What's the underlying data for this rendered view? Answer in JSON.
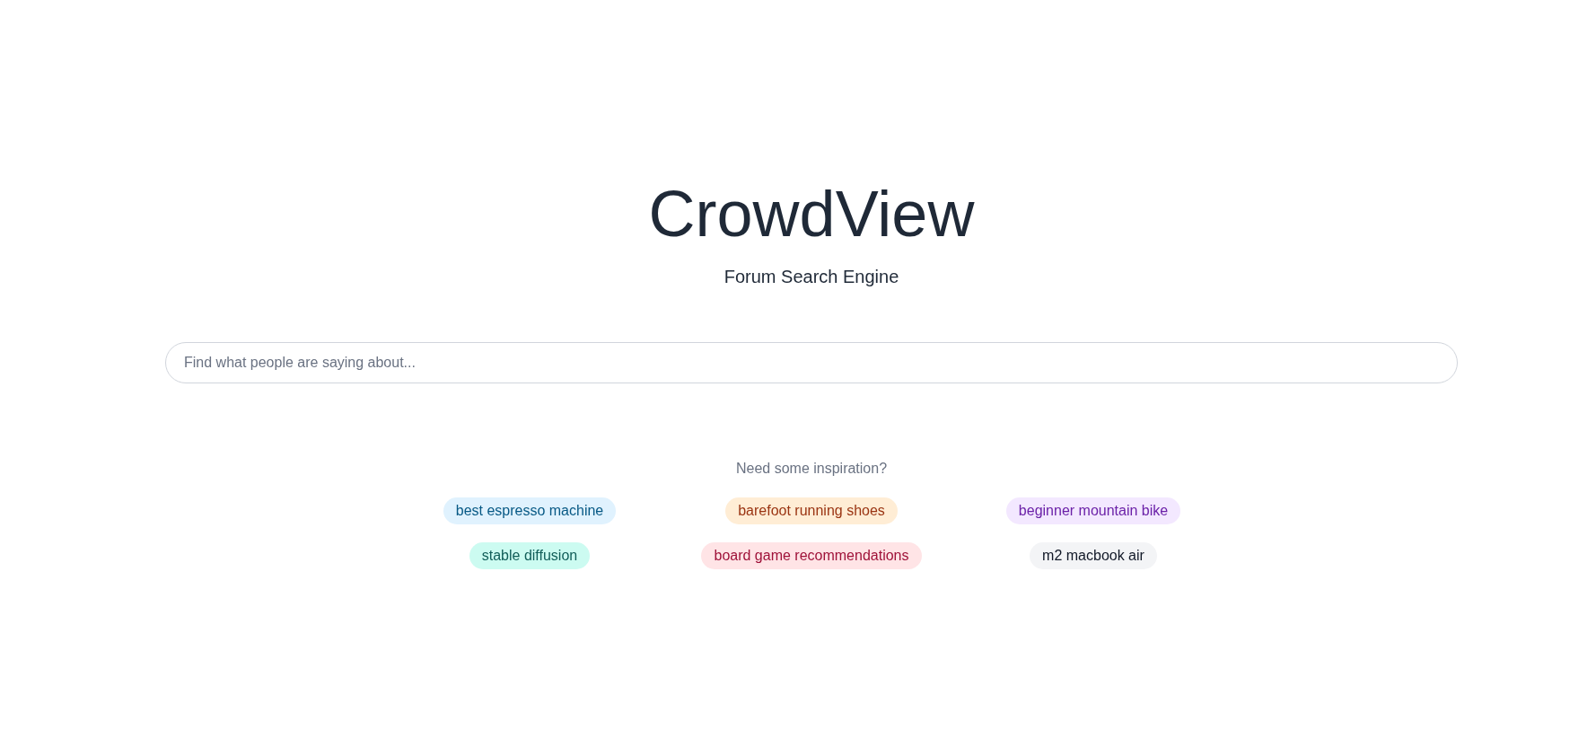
{
  "header": {
    "title": "CrowdView",
    "subtitle": "Forum Search Engine"
  },
  "search": {
    "placeholder": "Find what people are saying about..."
  },
  "suggestions": {
    "heading": "Need some inspiration?",
    "tags": [
      {
        "label": "best espresso machine",
        "color": "#075985"
      },
      {
        "label": "barefoot running shoes",
        "color": "#9a3412"
      },
      {
        "label": "beginner mountain bike",
        "color": "#6b21a8"
      },
      {
        "label": "stable diffusion",
        "color": "#115e59"
      },
      {
        "label": "board game recommendations",
        "color": "#9f1239"
      },
      {
        "label": "m2 macbook air",
        "color": "#111827"
      }
    ]
  }
}
